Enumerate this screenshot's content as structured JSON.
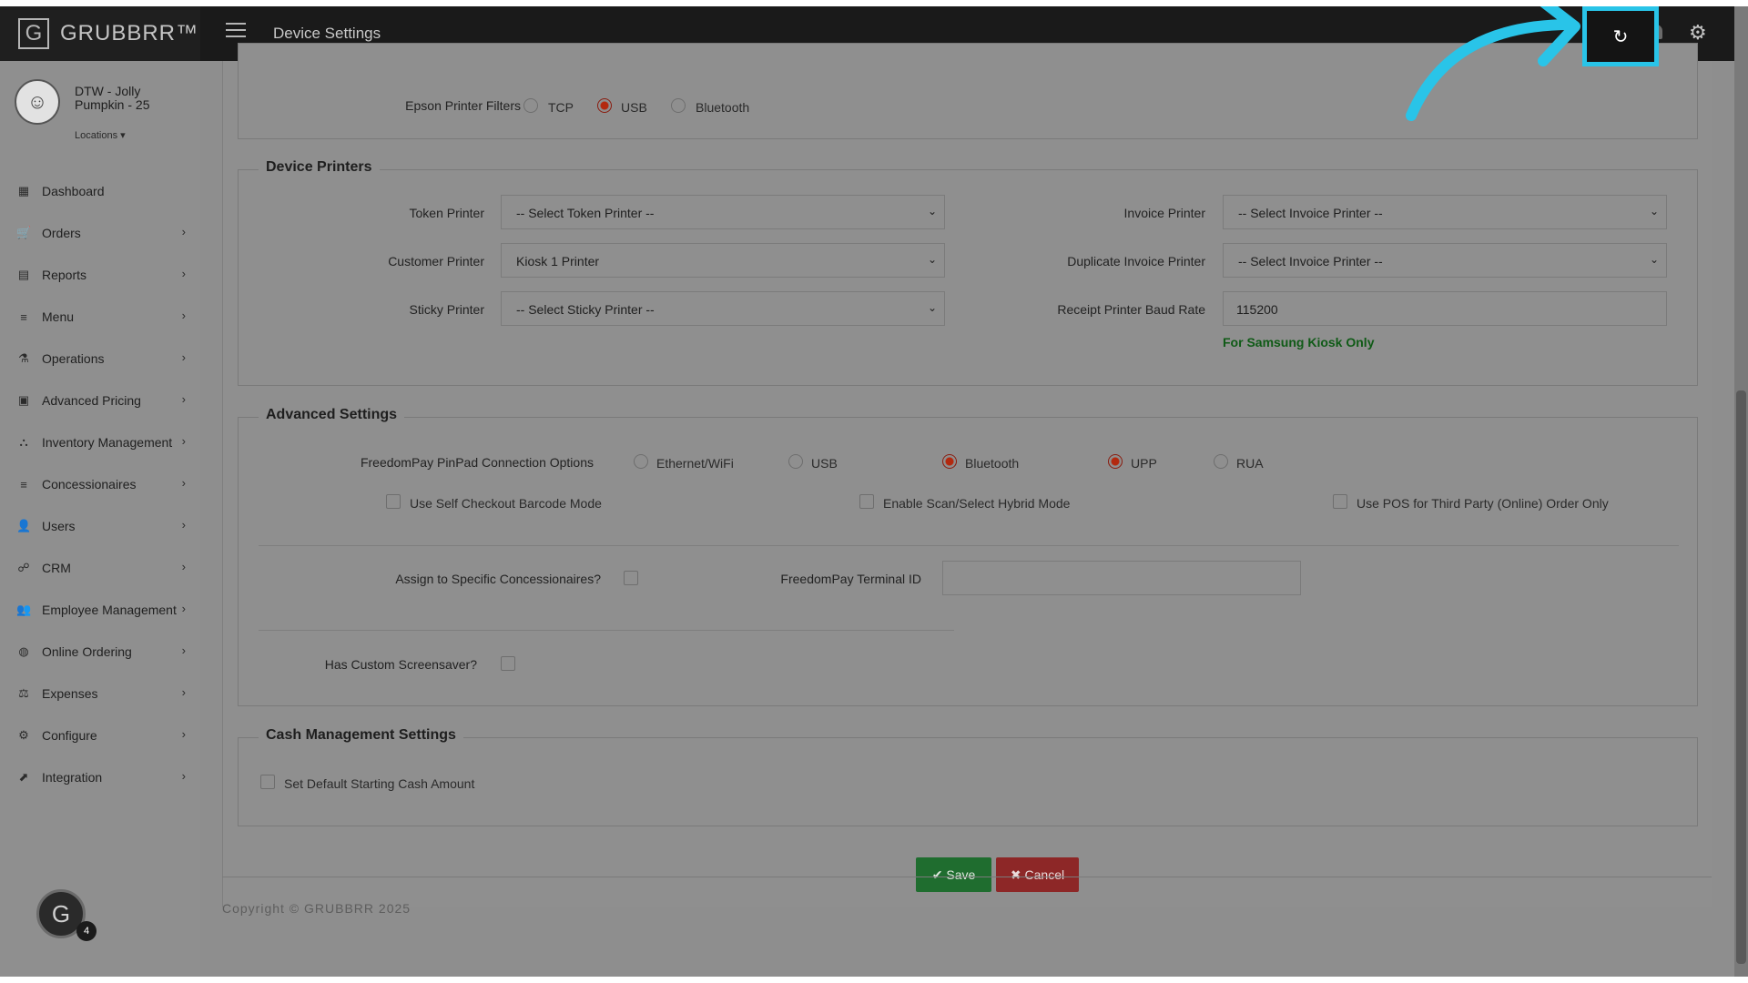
{
  "brand": {
    "logo_letter": "G",
    "name": "GRUBBRR™"
  },
  "header": {
    "title": "Device Settings"
  },
  "top_icons": {
    "refresh": "↻",
    "gear": "⚙"
  },
  "profile": {
    "store_name": "DTW - Jolly Pumpkin - 25",
    "locations_label": "Locations ▾"
  },
  "sidebar": {
    "items": [
      {
        "icon": "▦",
        "label": "Dashboard",
        "chevron": ""
      },
      {
        "icon": "🛒",
        "label": "Orders",
        "chevron": "›"
      },
      {
        "icon": "▤",
        "label": "Reports",
        "chevron": "›"
      },
      {
        "icon": "≡",
        "label": "Menu",
        "chevron": "›"
      },
      {
        "icon": "⚗",
        "label": "Operations",
        "chevron": "›"
      },
      {
        "icon": "▣",
        "label": "Advanced Pricing",
        "chevron": "›"
      },
      {
        "icon": "⛬",
        "label": "Inventory Management",
        "chevron": "›"
      },
      {
        "icon": "≡",
        "label": "Concessionaires",
        "chevron": "›"
      },
      {
        "icon": "👤",
        "label": "Users",
        "chevron": "›"
      },
      {
        "icon": "☍",
        "label": "CRM",
        "chevron": "›"
      },
      {
        "icon": "👥",
        "label": "Employee Management",
        "chevron": "›"
      },
      {
        "icon": "◍",
        "label": "Online Ordering",
        "chevron": "›"
      },
      {
        "icon": "⚖",
        "label": "Expenses",
        "chevron": "›"
      },
      {
        "icon": "⚙",
        "label": "Configure",
        "chevron": "›"
      },
      {
        "icon": "⬈",
        "label": "Integration",
        "chevron": "›"
      }
    ]
  },
  "epson": {
    "label": "Epson Printer Filters",
    "options": [
      "TCP",
      "USB",
      "Bluetooth"
    ],
    "selected": "USB"
  },
  "device_printers": {
    "title": "Device Printers",
    "token_printer": {
      "label": "Token Printer",
      "value": "-- Select Token Printer --"
    },
    "customer_printer": {
      "label": "Customer Printer",
      "value": "Kiosk 1 Printer"
    },
    "sticky_printer": {
      "label": "Sticky Printer",
      "value": "-- Select Sticky Printer --"
    },
    "invoice_printer": {
      "label": "Invoice Printer",
      "value": "-- Select Invoice Printer --"
    },
    "duplicate_invoice_printer": {
      "label": "Duplicate Invoice Printer",
      "value": "-- Select Invoice Printer --"
    },
    "baud_rate": {
      "label": "Receipt Printer Baud Rate",
      "value": "115200"
    },
    "note": "For Samsung Kiosk Only"
  },
  "advanced": {
    "title": "Advanced Settings",
    "pinpad_label": "FreedomPay PinPad Connection Options",
    "pinpad_options": [
      "Ethernet/WiFi",
      "USB",
      "Bluetooth",
      "UPP",
      "RUA"
    ],
    "checks": [
      "Use Self Checkout Barcode Mode",
      "Enable Scan/Select Hybrid Mode",
      "Use POS for Third Party (Online) Order Only"
    ],
    "assign_label": "Assign to Specific Concessionaires?",
    "terminal_label": "FreedomPay Terminal ID",
    "terminal_value": "",
    "screensaver_label": "Has Custom Screensaver?"
  },
  "cash": {
    "title": "Cash Management Settings",
    "check_label": "Set Default Starting Cash Amount"
  },
  "actions": {
    "save": "✔ Save",
    "cancel": "✖ Cancel"
  },
  "footer": {
    "copyright": "Copyright © GRUBBRR 2025"
  },
  "assistant": {
    "letter": "G",
    "count": "4"
  },
  "colors": {
    "highlight": "#29c4e8",
    "save": "#1f6d2f",
    "cancel": "#8d2727",
    "note": "#0f5a16"
  }
}
